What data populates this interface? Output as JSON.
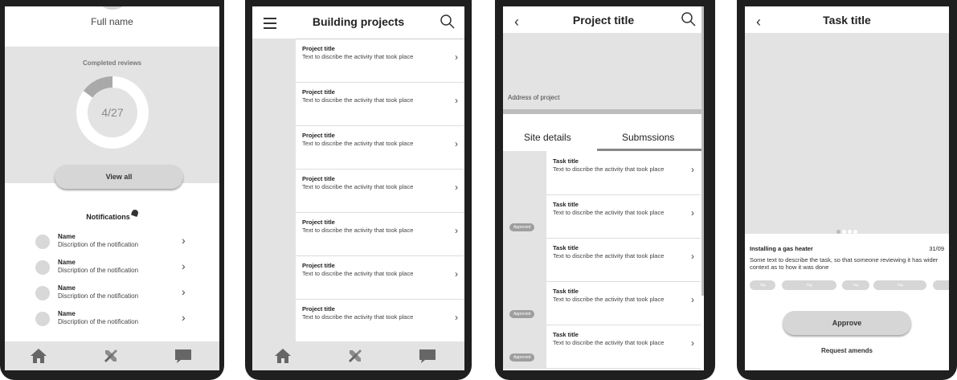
{
  "profile": {
    "full_name": "Full name",
    "reviews_label": "Completed reviews",
    "reviews_value": "4/27",
    "reviews_fraction": 0.148,
    "view_all": "View all",
    "notifications_title": "Notifications",
    "notifications": [
      {
        "name": "Name",
        "desc": "Discription of the notification"
      },
      {
        "name": "Name",
        "desc": "Discription of the notification"
      },
      {
        "name": "Name",
        "desc": "Discription of the notification"
      },
      {
        "name": "Name",
        "desc": "Discription of the notification"
      }
    ]
  },
  "projects": {
    "title": "Building projects",
    "rows": [
      {
        "title": "Project title",
        "desc": "Text to discribe the activity that took place"
      },
      {
        "title": "Project title",
        "desc": "Text to discribe the activity that took place"
      },
      {
        "title": "Project title",
        "desc": "Text to discribe the activity that took place"
      },
      {
        "title": "Project title",
        "desc": "Text to discribe the activity that took place"
      },
      {
        "title": "Project title",
        "desc": "Text to discribe the activity that took place"
      },
      {
        "title": "Project title",
        "desc": "Text to discribe the activity that took place"
      },
      {
        "title": "Project title",
        "desc": "Text to discribe the activity that took place"
      }
    ]
  },
  "project": {
    "title": "Project title",
    "address": "Address of project",
    "tab_site": "Site details",
    "tab_submissions": "Submssions",
    "tasks": [
      {
        "title": "Task title",
        "desc": "Text to discribe the activity that took place",
        "badge": ""
      },
      {
        "title": "Task title",
        "desc": "Text to discribe the activity that took place",
        "badge": "Approved"
      },
      {
        "title": "Task title",
        "desc": "Text to discribe the activity that took place",
        "badge": ""
      },
      {
        "title": "Task title",
        "desc": "Text to discribe the activity that took place",
        "badge": "Approved"
      },
      {
        "title": "Task title",
        "desc": "Text to discribe the activity that took place",
        "badge": "Approved"
      }
    ]
  },
  "task": {
    "title": "Task title",
    "heading": "Installing a gas heater",
    "date": "31/09",
    "desc": "Some text to describe the task, so that someone reviewing it has wider context as to how it was done",
    "tags": [
      "Tag",
      "Tag",
      "Tag",
      "Tag"
    ],
    "approve": "Approve",
    "request_amends": "Request amends"
  },
  "icons": {
    "home": "home-icon",
    "tools": "tools-icon",
    "chat": "chat-icon",
    "menu": "menu-icon",
    "search": "search-icon",
    "back": "back-icon",
    "bell": "bell-icon"
  }
}
